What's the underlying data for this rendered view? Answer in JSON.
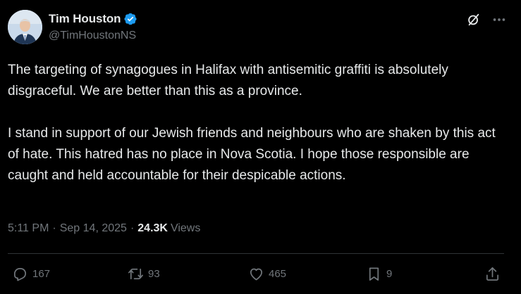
{
  "author": {
    "display_name": "Tim Houston",
    "handle": "@TimHoustonNS",
    "verified": true
  },
  "tweet": {
    "paragraphs": [
      "The targeting of synagogues in Halifax with antisemitic graffiti is absolutely disgraceful. We are better than this as a province.",
      "I stand in support of our Jewish friends and neighbours who are shaken by this act of hate. This hatred has no place in Nova Scotia. I hope those responsible are caught and held accountable for their despicable actions."
    ],
    "time": "5:11 PM",
    "date": "Sep 14, 2025",
    "separator": "·",
    "views_count": "24.3K",
    "views_label": "Views"
  },
  "actions": {
    "replies": "167",
    "reposts": "93",
    "likes": "465",
    "bookmarks": "9"
  },
  "icons": {
    "verified": "verified-badge-icon",
    "grok": "grok-icon",
    "more": "more-horizontal-icon",
    "reply": "reply-icon",
    "repost": "repost-icon",
    "like": "heart-icon",
    "bookmark": "bookmark-icon",
    "share": "share-icon"
  },
  "colors": {
    "background": "#000000",
    "text_primary": "#e7e9ea",
    "text_secondary": "#71767b",
    "verified_blue": "#1d9bf0",
    "divider": "#2f3336"
  }
}
